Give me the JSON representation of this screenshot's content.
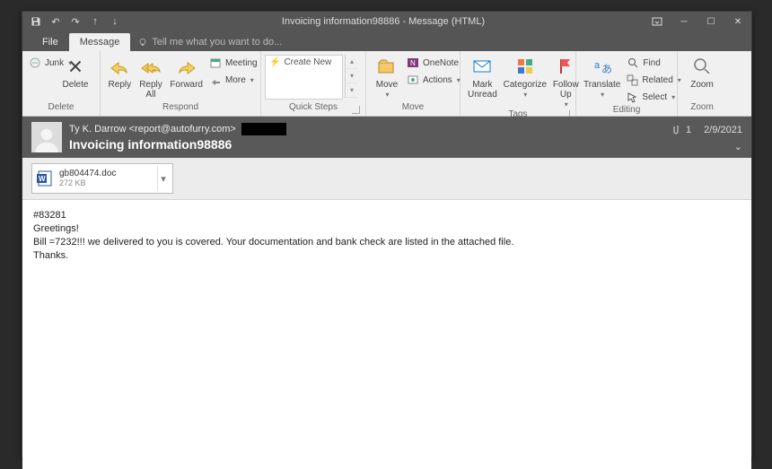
{
  "window": {
    "title": "Invoicing information98886 - Message (HTML)"
  },
  "tabs": {
    "file": "File",
    "message": "Message",
    "tellme": "Tell me what you want to do..."
  },
  "ribbon": {
    "delete": {
      "junk": "Junk",
      "delete": "Delete",
      "group": "Delete"
    },
    "respond": {
      "reply": "Reply",
      "replyall": "Reply\nAll",
      "forward": "Forward",
      "meeting": "Meeting",
      "more": "More",
      "group": "Respond"
    },
    "quicksteps": {
      "create": "Create New",
      "group": "Quick Steps"
    },
    "move": {
      "move": "Move",
      "onenote": "OneNote",
      "actions": "Actions",
      "group": "Move"
    },
    "tags": {
      "unread": "Mark\nUnread",
      "categorize": "Categorize",
      "followup": "Follow\nUp",
      "group": "Tags"
    },
    "editing": {
      "translate": "Translate",
      "find": "Find",
      "related": "Related",
      "select": "Select",
      "group": "Editing"
    },
    "zoom": {
      "zoom": "Zoom",
      "group": "Zoom"
    }
  },
  "header": {
    "from": "Ty K. Darrow <report@autofurry.com>",
    "subject": "Invoicing information98886",
    "attcount": "1",
    "date": "2/9/2021"
  },
  "attachment": {
    "filename": "gb804474.doc",
    "size": "272 KB"
  },
  "body": {
    "l1": "#83281",
    "l2": "Greetings!",
    "l3": "Bill =7232!!! we delivered to you is covered. Your documentation and bank check are listed in the attached file.",
    "l4": "Thanks."
  }
}
